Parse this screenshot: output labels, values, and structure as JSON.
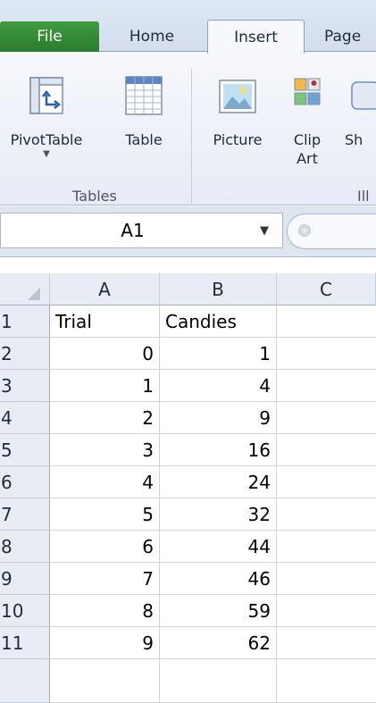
{
  "ribbon_tabs": {
    "file": "File",
    "home": "Home",
    "insert": "Insert",
    "page": "Page"
  },
  "ribbon": {
    "buttons": {
      "pivottable": "PivotTable",
      "table": "Table",
      "picture": "Picture",
      "clip_art_line1": "Clip",
      "clip_art_line2": "Art",
      "shapes_partial": "Sh"
    },
    "groups": {
      "tables": "Tables",
      "illustrations_partial": "Ill"
    }
  },
  "formula_bar": {
    "name_box": "A1"
  },
  "sheet": {
    "columns": [
      "A",
      "B",
      "C"
    ],
    "rows": [
      {
        "num": "1",
        "a": "Trial",
        "b": "Candies",
        "c": ""
      },
      {
        "num": "2",
        "a": "0",
        "b": "1",
        "c": ""
      },
      {
        "num": "3",
        "a": "1",
        "b": "4",
        "c": ""
      },
      {
        "num": "4",
        "a": "2",
        "b": "9",
        "c": ""
      },
      {
        "num": "5",
        "a": "3",
        "b": "16",
        "c": ""
      },
      {
        "num": "6",
        "a": "4",
        "b": "24",
        "c": ""
      },
      {
        "num": "7",
        "a": "5",
        "b": "32",
        "c": ""
      },
      {
        "num": "8",
        "a": "6",
        "b": "44",
        "c": ""
      },
      {
        "num": "9",
        "a": "7",
        "b": "46",
        "c": ""
      },
      {
        "num": "10",
        "a": "8",
        "b": "59",
        "c": ""
      },
      {
        "num": "11",
        "a": "9",
        "b": "62",
        "c": ""
      }
    ]
  },
  "colors": {
    "file_tab": "#2a7c2b",
    "ribbon_bg": "#f6f8fc",
    "header_bg": "#e8edf4",
    "gridline": "#d4d4d4"
  }
}
